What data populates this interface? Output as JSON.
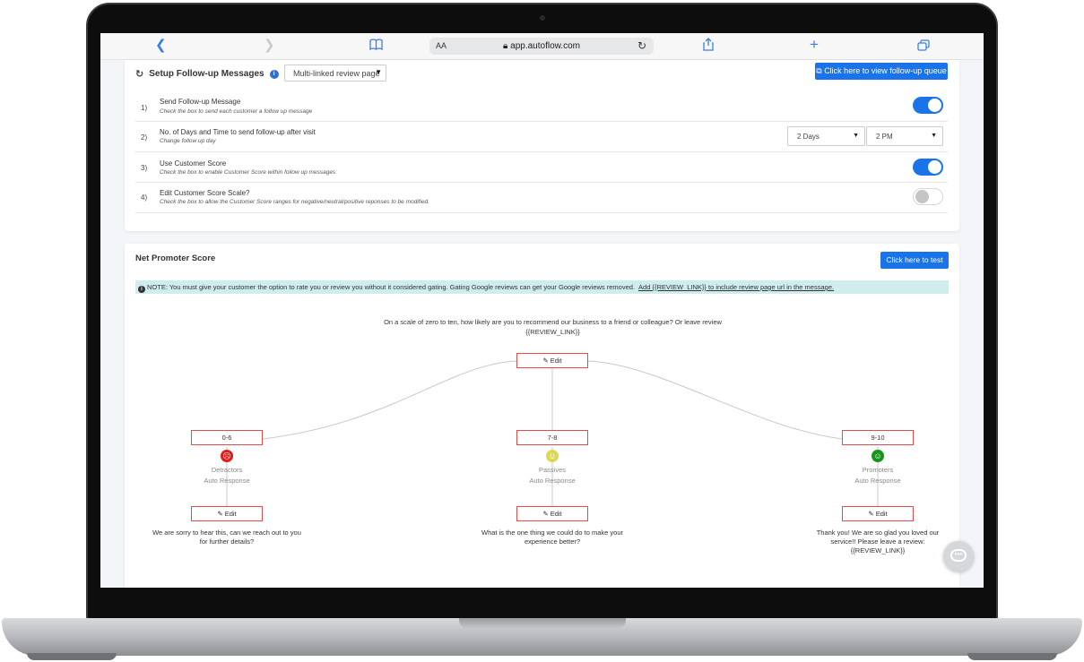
{
  "browser": {
    "url": "app.autoflow.com",
    "text_size_label": "AA"
  },
  "followup": {
    "title": "Setup Follow-up Messages",
    "page_select": "Multi-linked review page",
    "queue_button": "Click here to view follow-up queue",
    "rows": [
      {
        "num": "1)",
        "label": "Send Follow-up Message",
        "sub": "Check the box to send each customer a follow up message",
        "toggle": true
      },
      {
        "num": "2)",
        "label": "No. of Days and Time to send follow-up after visit",
        "sub": "Change follow up day",
        "days": "2 Days",
        "time": "2 PM"
      },
      {
        "num": "3)",
        "label": "Use Customer Score",
        "sub": "Check the box to enable Customer Score within follow up messages",
        "toggle": true
      },
      {
        "num": "4)",
        "label": "Edit Customer Score Scale?",
        "sub": "Check the box to allow the Customer Score ranges for negative/neutral/positive reponses to be modified.",
        "toggle": false
      }
    ]
  },
  "nps": {
    "title": "Net Promoter Score",
    "test_button": "Click here to test",
    "note": "NOTE: You must give your customer the option to rate you or review you without it considered gating. Gating Google reviews can get your Google reviews removed.",
    "note_link": "Add {{REVIEW_LINK}} to include review page url in the message.",
    "question_line1": "On a scale of zero to ten, how likely are you to recommend our business to a friend or colleague? Or leave review",
    "question_line2": "{{REVIEW_LINK}}",
    "edit_label": "Edit",
    "branches": [
      {
        "range": "0-6",
        "category": "Detractors",
        "auto": "Auto Response",
        "face": "red",
        "response": "We are sorry to hear this, can we reach out to you for further details?"
      },
      {
        "range": "7-8",
        "category": "Passives",
        "auto": "Auto Response",
        "face": "yellow",
        "response": "What is the one thing we could do to make your experience better?"
      },
      {
        "range": "9-10",
        "category": "Promoters",
        "auto": "Auto Response",
        "face": "green",
        "response": "Thank you! We are so glad you loved our service!! Please leave a review: {{REVIEW_LINK}}"
      }
    ]
  },
  "colors": {
    "primary": "#1a73e8",
    "note_bg": "#cfecee",
    "edit_border": "#e24b4b",
    "detractor": "#e81919",
    "passive": "#dcd758",
    "promoter": "#17951b"
  }
}
